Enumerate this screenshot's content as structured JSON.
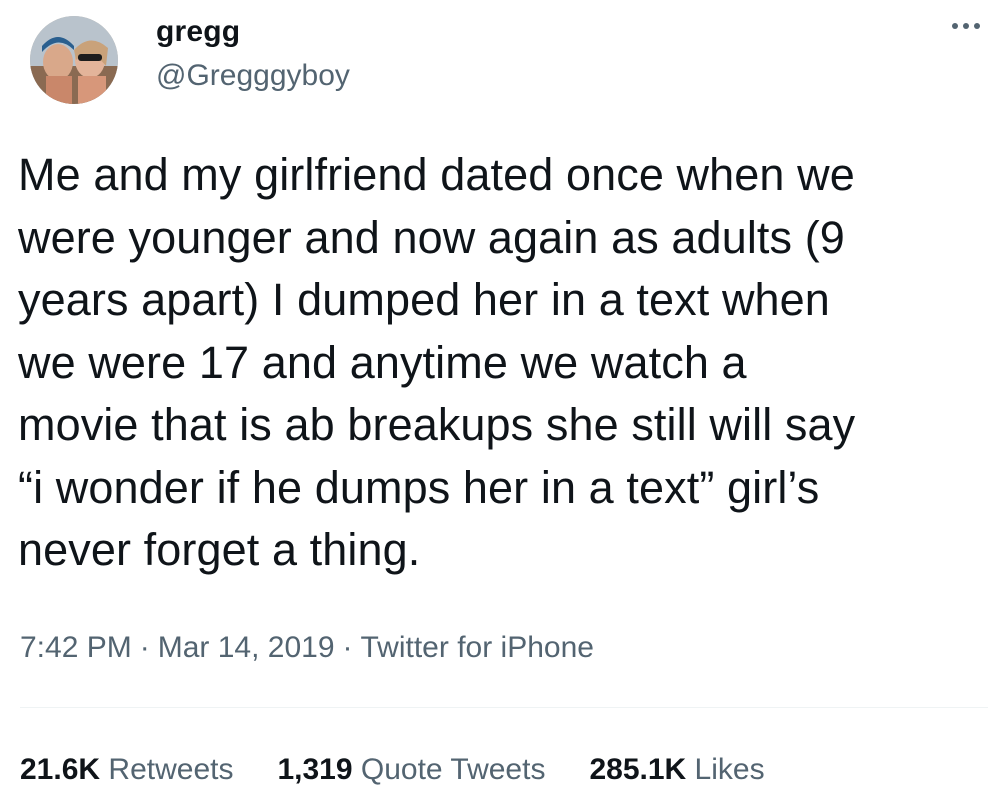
{
  "user": {
    "display_name": "gregg",
    "handle": "@Gregggyboy",
    "avatar_icon": "profile-photo"
  },
  "menu": {
    "icon": "more-horizontal-icon"
  },
  "tweet": {
    "text": "Me and my girlfriend dated once when we\nwere younger and now again as adults (9\nyears apart) I dumped her in a text when\nwe were 17 and anytime we watch a\nmovie that is ab breakups she still will say\n“i wonder if he dumps her in a text” girl’s\nnever forget a thing."
  },
  "meta": {
    "time": "7:42 PM",
    "separator": "·",
    "date": "Mar 14, 2019",
    "source": "Twitter for iPhone"
  },
  "stats": {
    "retweets_count": "21.6K",
    "retweets_label": "Retweets",
    "quotes_count": "1,319",
    "quotes_label": "Quote Tweets",
    "likes_count": "285.1K",
    "likes_label": "Likes"
  },
  "colors": {
    "text_primary": "#0f1419",
    "text_secondary": "#536471",
    "divider": "#eff3f4"
  }
}
